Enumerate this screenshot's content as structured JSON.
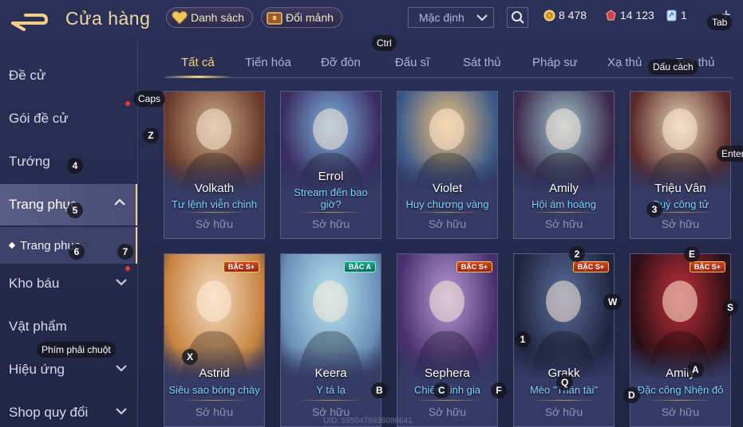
{
  "header": {
    "title": "Cửa hàng",
    "list_button": "Danh sách",
    "exchange_button": "Đổi mảnh",
    "sort_selected": "Mặc định"
  },
  "currencies": [
    {
      "icon": "gold-coin-icon",
      "value": "8 478"
    },
    {
      "icon": "ruby-gem-icon",
      "value": "14 123"
    },
    {
      "icon": "voucher-icon",
      "value": "1"
    }
  ],
  "sidebar": {
    "items": [
      {
        "label": "Đề cử"
      },
      {
        "label": "Gói đề cử"
      },
      {
        "label": "Tướng"
      },
      {
        "label": "Trang phục"
      },
      {
        "label": "Trang phục"
      },
      {
        "label": "Kho báu"
      },
      {
        "label": "Vật phẩm"
      },
      {
        "label": "Hiệu ứng"
      },
      {
        "label": "Shop quy đổi"
      }
    ]
  },
  "tabs": [
    "Tất cả",
    "Tiến hóa",
    "Đỡ đòn",
    "Đấu sĩ",
    "Sát thủ",
    "Pháp sư",
    "Xạ thủ",
    "Trợ thủ"
  ],
  "cards": [
    {
      "hero": "Volkath",
      "skin": "Tư lệnh viễn chinh",
      "status": "Sở hữu",
      "tier": "",
      "colors": [
        "#c9a98a",
        "#6b3a2a"
      ]
    },
    {
      "hero": "Errol",
      "skin": "Stream đến bao giờ?",
      "status": "Sở hữu",
      "tier": "",
      "colors": [
        "#7fb4e0",
        "#3a2c62"
      ]
    },
    {
      "hero": "Violet",
      "skin": "Huy chương vàng",
      "status": "Sở hữu",
      "tier": "",
      "colors": [
        "#f0c27a",
        "#3d5a8a"
      ]
    },
    {
      "hero": "Amily",
      "skin": "Hội ám hoàng",
      "status": "Sở hữu",
      "tier": "",
      "colors": [
        "#9fc6d0",
        "#3c2a4a"
      ]
    },
    {
      "hero": "Triệu Vân",
      "skin": "Quý công tử",
      "status": "Sở hữu",
      "tier": "",
      "colors": [
        "#e8d6b4",
        "#5a2a2a"
      ]
    },
    {
      "hero": "Astrid",
      "skin": "Siêu sao bóng chày",
      "status": "Sở hữu",
      "tier": "BẬC S+",
      "colors": [
        "#f4dcc0",
        "#c7823e"
      ]
    },
    {
      "hero": "Keera",
      "skin": "Y tá lạ",
      "status": "Sở hữu",
      "tier": "BẬC A",
      "colors": [
        "#b8e6ef",
        "#6a8fb8"
      ]
    },
    {
      "hero": "Sephera",
      "skin": "Chiêm tinh gia",
      "status": "Sở hữu",
      "tier": "BẬC S+",
      "colors": [
        "#b59ad6",
        "#4a2f6e"
      ]
    },
    {
      "hero": "Grakk",
      "skin": "Mèo \"Thần tài\"",
      "status": "Sở hữu",
      "tier": "BẬC S+",
      "colors": [
        "#5a6e9a",
        "#1e243d"
      ]
    },
    {
      "hero": "Amily",
      "skin": "Đặc công Nhện đỏ",
      "status": "Sở hữu",
      "tier": "BẬC S+",
      "colors": [
        "#c0303a",
        "#2a0e14"
      ]
    }
  ],
  "key_hints": {
    "ctrl": "Ctrl",
    "tab": "Tab",
    "caps": "Caps",
    "space": "Dấu cách",
    "enter": "Enter",
    "right_click": "Phím phải chuột",
    "z": "Z",
    "k4": "4",
    "k5": "5",
    "k6": "6",
    "k7": "7",
    "k3": "3",
    "k2": "2",
    "e": "E",
    "w": "W",
    "s": "S",
    "x": "X",
    "b": "B",
    "c": "C",
    "f": "F",
    "q": "Q",
    "k1": "1",
    "a": "A",
    "d": "D"
  },
  "uid": "UID: 5950476936086641"
}
